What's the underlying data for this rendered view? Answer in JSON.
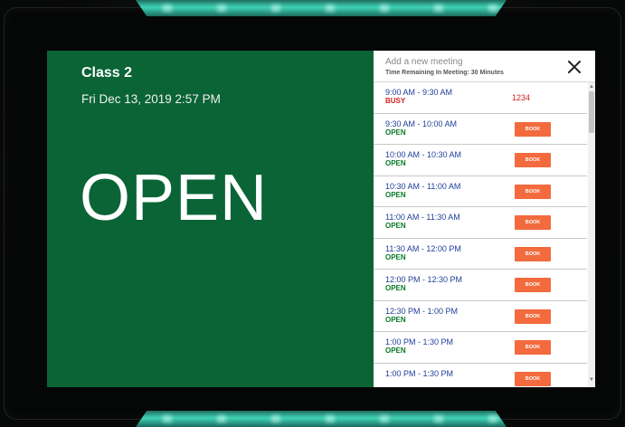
{
  "room": {
    "name": "Class 2",
    "datetime": "Fri Dec 13, 2019 2:57 PM",
    "status": "OPEN"
  },
  "booking": {
    "add_placeholder": "Add a new meeting",
    "time_remaining": "Time Remaining In Meeting: 30 Minutes",
    "close_icon": "close-icon",
    "slots": [
      {
        "time": "9:00 AM - 9:30 AM",
        "state": "BUSY",
        "meeting_id": "1234"
      },
      {
        "time": "9:30 AM - 10:00 AM",
        "state": "OPEN",
        "action": "BOOK"
      },
      {
        "time": "10:00 AM - 10:30 AM",
        "state": "OPEN",
        "action": "BOOK"
      },
      {
        "time": "10:30 AM - 11:00 AM",
        "state": "OPEN",
        "action": "BOOK"
      },
      {
        "time": "11:00 AM - 11:30 AM",
        "state": "OPEN",
        "action": "BOOK"
      },
      {
        "time": "11:30 AM - 12:00 PM",
        "state": "OPEN",
        "action": "BOOK"
      },
      {
        "time": "12:00 PM - 12:30 PM",
        "state": "OPEN",
        "action": "BOOK"
      },
      {
        "time": "12:30 PM - 1:00 PM",
        "state": "OPEN",
        "action": "BOOK"
      },
      {
        "time": "1:00 PM - 1:30 PM",
        "state": "OPEN",
        "action": "BOOK"
      },
      {
        "time": "1:00 PM - 1:30 PM",
        "state": "",
        "action": "BOOK"
      }
    ]
  },
  "colors": {
    "status_green": "#0a6436",
    "book_orange": "#f26a3d",
    "time_blue": "#1f3f9a",
    "busy_red": "#d02020",
    "open_green": "#0a7a2a",
    "led_teal": "#3fd3b7"
  }
}
